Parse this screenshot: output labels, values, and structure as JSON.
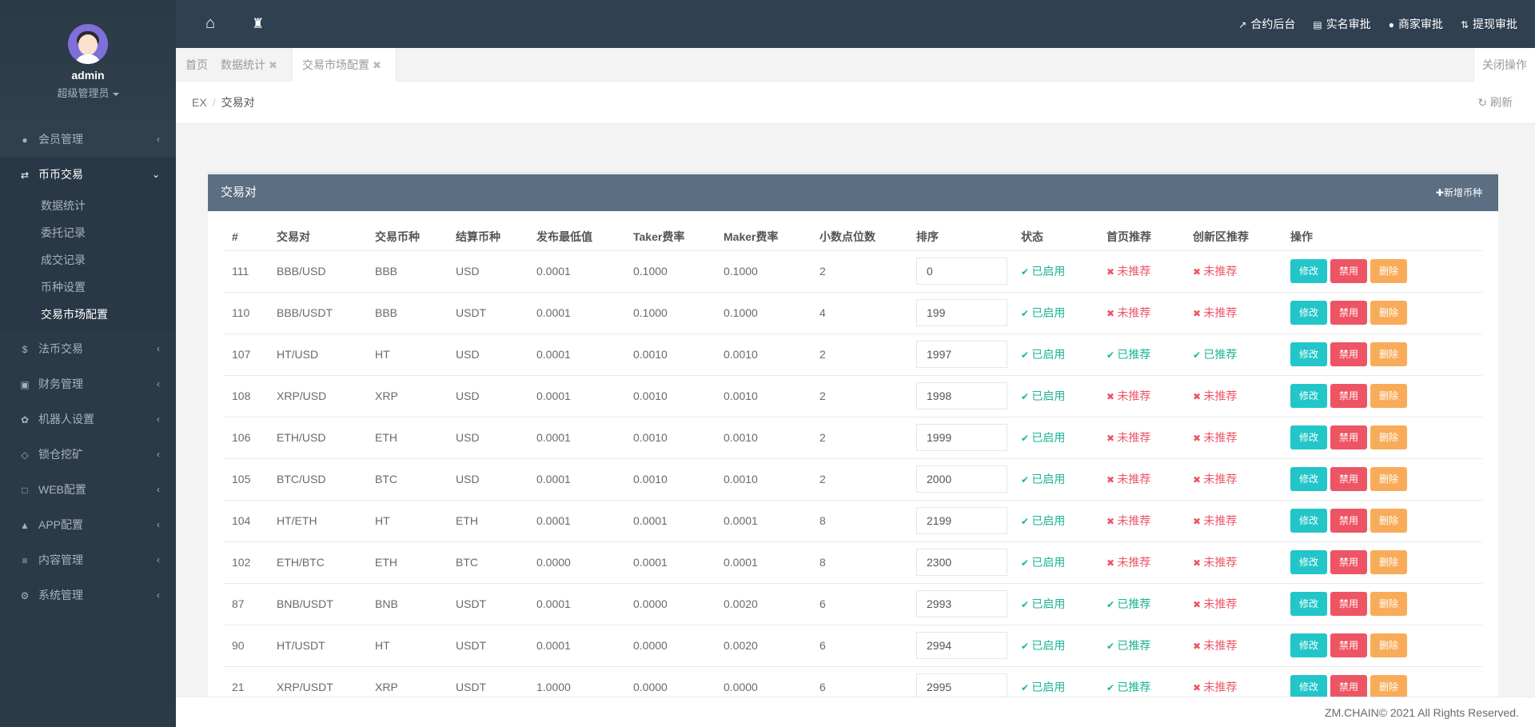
{
  "user": {
    "name": "admin",
    "role": "超级管理员"
  },
  "sidebar": {
    "items": [
      {
        "label": "会员管理",
        "icon": "user-icon"
      },
      {
        "label": "币币交易",
        "icon": "exchange-icon"
      },
      {
        "label": "法币交易",
        "icon": "dollar-icon"
      },
      {
        "label": "财务管理",
        "icon": "money-icon"
      },
      {
        "label": "机器人设置",
        "icon": "paw-icon"
      },
      {
        "label": "锁仓挖矿",
        "icon": "diamond-icon"
      },
      {
        "label": "WEB配置",
        "icon": "laptop-icon"
      },
      {
        "label": "APP配置",
        "icon": "android-icon"
      },
      {
        "label": "内容管理",
        "icon": "list-icon"
      },
      {
        "label": "系统管理",
        "icon": "cogs-icon"
      }
    ],
    "sub_items": [
      "数据统计",
      "委托记录",
      "成交记录",
      "币种设置",
      "交易市场配置"
    ]
  },
  "topbar": {
    "links": [
      "合约后台",
      "实名审批",
      "商家审批",
      "提现审批"
    ]
  },
  "tabs": {
    "home": "首页",
    "items": [
      "数据统计",
      "交易市场配置"
    ],
    "close_ops": "关闭操作"
  },
  "breadcrumb": {
    "root": "EX",
    "current": "交易对",
    "refresh": "刷新"
  },
  "panel": {
    "title": "交易对",
    "add_button": "新增币种",
    "columns": [
      "#",
      "交易对",
      "交易币种",
      "结算币种",
      "发布最低值",
      "Taker费率",
      "Maker费率",
      "小数点位数",
      "排序",
      "状态",
      "首页推荐",
      "创新区推荐",
      "操作"
    ],
    "rows": [
      {
        "id": "111",
        "pair": "BBB/USD",
        "coin": "BBB",
        "settle": "USD",
        "min": "0.0001",
        "taker": "0.1000",
        "maker": "0.1000",
        "decimals": "2",
        "sort": "0",
        "status": "已启用",
        "home": "未推荐",
        "innov": "未推荐"
      },
      {
        "id": "110",
        "pair": "BBB/USDT",
        "coin": "BBB",
        "settle": "USDT",
        "min": "0.0001",
        "taker": "0.1000",
        "maker": "0.1000",
        "decimals": "4",
        "sort": "199",
        "status": "已启用",
        "home": "未推荐",
        "innov": "未推荐"
      },
      {
        "id": "107",
        "pair": "HT/USD",
        "coin": "HT",
        "settle": "USD",
        "min": "0.0001",
        "taker": "0.0010",
        "maker": "0.0010",
        "decimals": "2",
        "sort": "1997",
        "status": "已启用",
        "home": "已推荐",
        "innov": "已推荐"
      },
      {
        "id": "108",
        "pair": "XRP/USD",
        "coin": "XRP",
        "settle": "USD",
        "min": "0.0001",
        "taker": "0.0010",
        "maker": "0.0010",
        "decimals": "2",
        "sort": "1998",
        "status": "已启用",
        "home": "未推荐",
        "innov": "未推荐"
      },
      {
        "id": "106",
        "pair": "ETH/USD",
        "coin": "ETH",
        "settle": "USD",
        "min": "0.0001",
        "taker": "0.0010",
        "maker": "0.0010",
        "decimals": "2",
        "sort": "1999",
        "status": "已启用",
        "home": "未推荐",
        "innov": "未推荐"
      },
      {
        "id": "105",
        "pair": "BTC/USD",
        "coin": "BTC",
        "settle": "USD",
        "min": "0.0001",
        "taker": "0.0010",
        "maker": "0.0010",
        "decimals": "2",
        "sort": "2000",
        "status": "已启用",
        "home": "未推荐",
        "innov": "未推荐"
      },
      {
        "id": "104",
        "pair": "HT/ETH",
        "coin": "HT",
        "settle": "ETH",
        "min": "0.0001",
        "taker": "0.0001",
        "maker": "0.0001",
        "decimals": "8",
        "sort": "2199",
        "status": "已启用",
        "home": "未推荐",
        "innov": "未推荐"
      },
      {
        "id": "102",
        "pair": "ETH/BTC",
        "coin": "ETH",
        "settle": "BTC",
        "min": "0.0000",
        "taker": "0.0001",
        "maker": "0.0001",
        "decimals": "8",
        "sort": "2300",
        "status": "已启用",
        "home": "未推荐",
        "innov": "未推荐"
      },
      {
        "id": "87",
        "pair": "BNB/USDT",
        "coin": "BNB",
        "settle": "USDT",
        "min": "0.0001",
        "taker": "0.0000",
        "maker": "0.0020",
        "decimals": "6",
        "sort": "2993",
        "status": "已启用",
        "home": "已推荐",
        "innov": "未推荐"
      },
      {
        "id": "90",
        "pair": "HT/USDT",
        "coin": "HT",
        "settle": "USDT",
        "min": "0.0001",
        "taker": "0.0000",
        "maker": "0.0020",
        "decimals": "6",
        "sort": "2994",
        "status": "已启用",
        "home": "已推荐",
        "innov": "未推荐"
      },
      {
        "id": "21",
        "pair": "XRP/USDT",
        "coin": "XRP",
        "settle": "USDT",
        "min": "1.0000",
        "taker": "0.0000",
        "maker": "0.0000",
        "decimals": "6",
        "sort": "2995",
        "status": "已启用",
        "home": "已推荐",
        "innov": "未推荐"
      }
    ],
    "actions": {
      "edit": "修改",
      "disable": "禁用",
      "delete": "删除"
    }
  },
  "footer": "ZM.CHAIN© 2021 All Rights Reserved.",
  "colors": {
    "sidebar": "#2b3a47",
    "topbar": "#2f4050",
    "panel_header": "#5b6e82",
    "enabled": "#1ab394",
    "not_recommended": "#ed5565",
    "edit": "#23c6c8",
    "disable": "#ed5565",
    "delete": "#f8ac59"
  }
}
